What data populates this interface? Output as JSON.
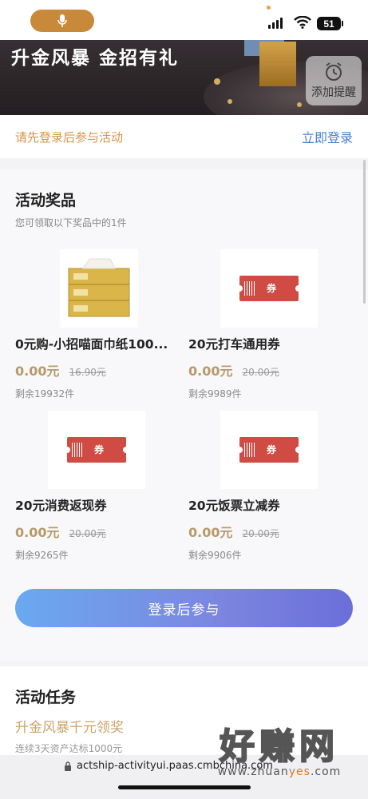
{
  "status_bar": {
    "battery": "51",
    "mic_icon": "microphone-icon"
  },
  "banner": {
    "title": "升金风暴 金招有礼",
    "reminder_label": "添加提醒"
  },
  "login_bar": {
    "hint": "请先登录后参与活动",
    "link": "立即登录"
  },
  "prizes": {
    "title": "活动奖品",
    "subtitle": "您可领取以下奖品中的1件",
    "items": [
      {
        "name": "0元购-小招喵面巾纸100...",
        "price": "0.00元",
        "original": "16.90元",
        "stock": "剩余19932件",
        "icon": "tissue-box"
      },
      {
        "name": "20元打车通用券",
        "price": "0.00元",
        "original": "20.00元",
        "stock": "剩余9989件",
        "icon": "coupon"
      },
      {
        "name": "20元消费返现券",
        "price": "0.00元",
        "original": "20.00元",
        "stock": "剩余9265件",
        "icon": "coupon"
      },
      {
        "name": "20元饭票立减券",
        "price": "0.00元",
        "original": "20.00元",
        "stock": "剩余9906件",
        "icon": "coupon"
      }
    ],
    "coupon_text": "券",
    "join_button": "登录后参与"
  },
  "tasks": {
    "title": "活动任务",
    "item_name": "升金风暴千元领奖",
    "item_sub": "连续3天资产达标1000元"
  },
  "url_bar": {
    "url": "actship-activityui.paas.cmbchina.com"
  },
  "watermark": {
    "big": "好赚网",
    "url_prefix": "www.zhuan",
    "url_highlight": "yes",
    "url_suffix": ".com"
  },
  "colors": {
    "accent_gold": "#c9893a",
    "link_blue": "#4a7fd6",
    "coupon_red": "#cf4b43",
    "price_gold": "#b79a6a"
  }
}
